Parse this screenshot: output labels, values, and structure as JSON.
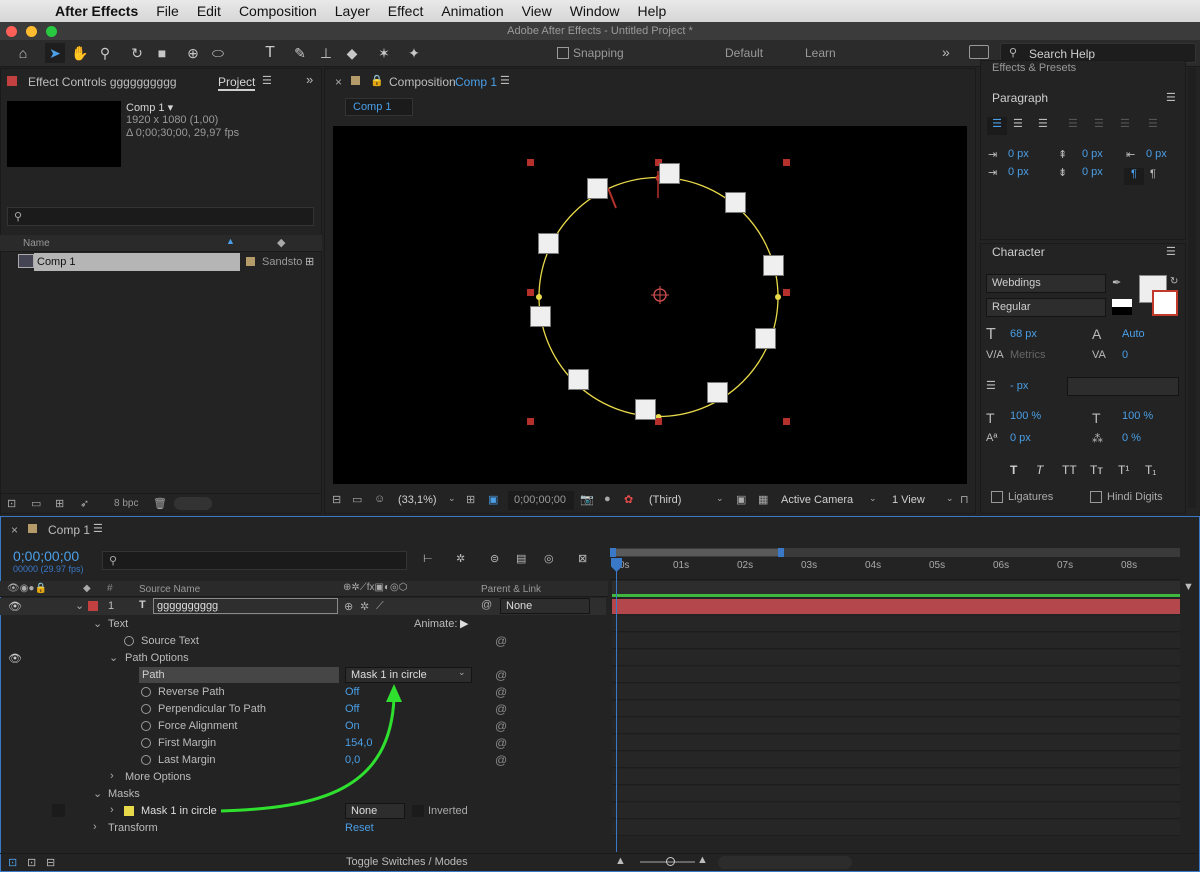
{
  "menubar": {
    "app": "After Effects",
    "items": [
      "File",
      "Edit",
      "Composition",
      "Layer",
      "Effect",
      "Animation",
      "View",
      "Window",
      "Help"
    ]
  },
  "window": {
    "title": "Adobe After Effects - Untitled Project *"
  },
  "toolbar": {
    "snapping": "Snapping",
    "workspace_default": "Default",
    "workspace_learn": "Learn",
    "search_placeholder": "Search Help"
  },
  "project_panel": {
    "tab_effect_controls": "Effect Controls gggggggggg",
    "tab_project": "Project",
    "comp_name": "Comp 1 ▾",
    "comp_size": "1920 x 1080 (1,00)",
    "comp_duration": "Δ 0;00;30;00, 29,97 fps",
    "col_name": "Name",
    "item_name": "Comp 1",
    "item_type": "Sandsto",
    "bpc": "8 bpc"
  },
  "comp_panel": {
    "tab_label": "Composition",
    "tab_comp": "Comp 1",
    "sub_tab": "Comp 1",
    "zoom": "(33,1%)",
    "timecode": "0;00;00;00",
    "resolution": "(Third)",
    "camera": "Active Camera",
    "views": "1 View"
  },
  "right_panel": {
    "effects_presets": "Effects & Presets",
    "paragraph_title": "Paragraph",
    "indent_values": [
      "0 px",
      "0 px",
      "0 px",
      "0 px",
      "0 px"
    ],
    "character_title": "Character",
    "font": "Webdings",
    "style": "Regular",
    "font_size": "68 px",
    "leading": "Auto",
    "kerning": "Metrics",
    "tracking": "0",
    "stroke": "- px",
    "vert_scale": "100 %",
    "horiz_scale": "100 %",
    "baseline": "0 px",
    "tsume": "0 %",
    "ligatures": "Ligatures",
    "hindi_digits": "Hindi Digits",
    "text_style_buttons": [
      "T",
      "T",
      "TT",
      "Tт",
      "T¹",
      "T₁"
    ]
  },
  "timeline": {
    "tab": "Comp 1",
    "timecode": "0;00;00;00",
    "fps": "00000 (29.97 fps)",
    "col_source": "Source Name",
    "col_parent": "Parent & Link",
    "layer": {
      "num": "1",
      "name": "gggggggggg",
      "parent": "None"
    },
    "props": {
      "text": "Text",
      "animate": "Animate:",
      "source_text": "Source Text",
      "path_options": "Path Options",
      "path": "Path",
      "path_value": "Mask 1 in circle",
      "reverse_path": "Reverse Path",
      "reverse_val": "Off",
      "perpendicular": "Perpendicular To Path",
      "perpendicular_val": "Off",
      "force_alignment": "Force Alignment",
      "force_val": "On",
      "first_margin": "First Margin",
      "first_val": "154,0",
      "last_margin": "Last Margin",
      "last_val": "0,0",
      "more_options": "More Options",
      "masks": "Masks",
      "mask_name": "Mask 1 in circle",
      "mask_mode": "None",
      "inverted": "Inverted",
      "transform": "Transform",
      "reset": "Reset"
    },
    "ruler": [
      "0s",
      "01s",
      "02s",
      "03s",
      "04s",
      "05s",
      "06s",
      "07s",
      "08s"
    ],
    "toggle": "Toggle Switches / Modes"
  },
  "colors": {
    "accent_blue": "#4a9fe8",
    "layer_bar": "#b4474b",
    "mask_yellow": "#e8d94a",
    "arrow_green": "#2fe02f"
  }
}
